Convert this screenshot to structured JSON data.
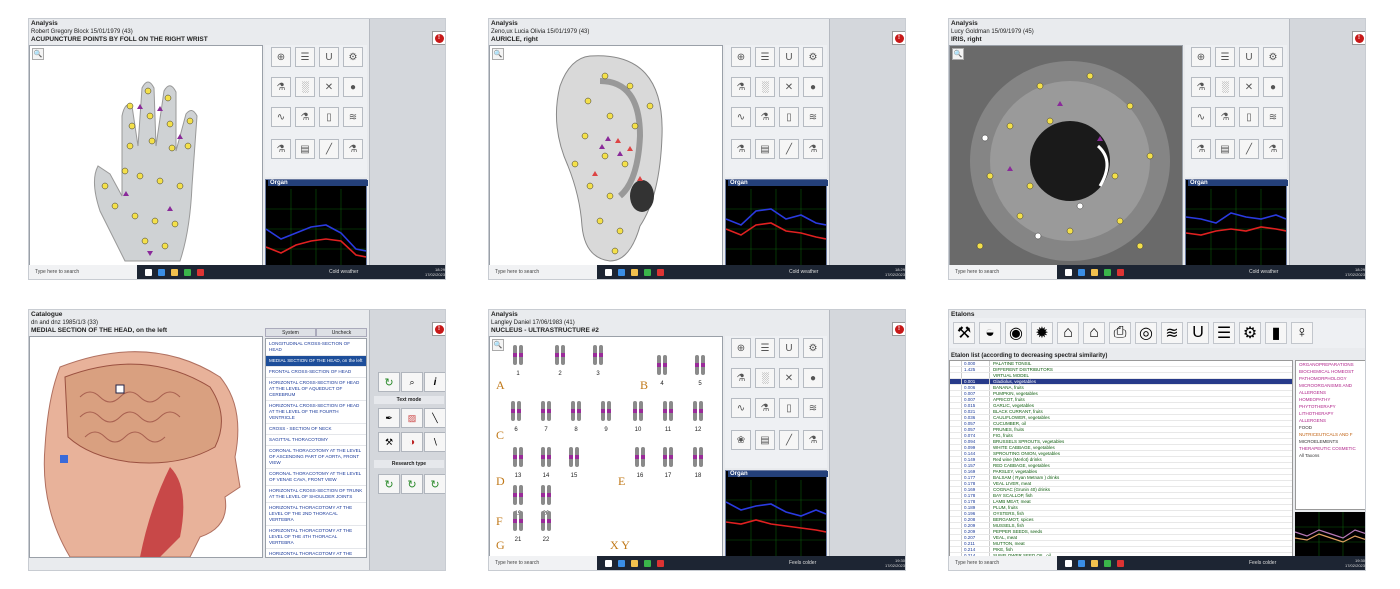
{
  "taskbar": {
    "search": "Type here to search",
    "weather_cold": "Cold weather",
    "weather_feels": "Feels colder",
    "clock_time": "18:29",
    "clock_date": "17/02/2023",
    "clock_time2": "19:30"
  },
  "panels": [
    {
      "title": "Analysis",
      "subject": "Robert Gregory Block 15/01/1979 (43)",
      "caption": "ACUPUNCTURE POINTS BY FOLL ON THE RIGHT WRIST",
      "organ": "Organ"
    },
    {
      "title": "Analysis",
      "subject": "Zeno,ux Lucia Olivia 15/01/1979 (43)",
      "caption": "AURICLE, right",
      "organ": "Organ"
    },
    {
      "title": "Analysis",
      "subject": "Lucy Goldman 15/09/1979 (45)",
      "caption": "IRIS, right",
      "organ": "Organ"
    },
    {
      "title": "Catalogue",
      "subject": "dn and dnz 1985/1/3 (33)",
      "caption": "MEDIAL SECTION OF THE HEAD, on the left",
      "tabs": [
        "System",
        "Uncheck"
      ],
      "items": [
        "LONGITUDINAL CROSS-SECTION OF HEAD",
        "MEDIAL SECTION OF THE HEAD, on the left",
        "FRONTAL CROSS-SECTION OF HEAD",
        "HORIZONTAL CROSS-SECTION OF HEAD AT THE LEVEL OF AQUEDUCT OF CEREBRUM",
        "HORIZONTAL CROSS-SECTION OF HEAD AT THE LEVEL OF THE FOURTH VENTRICLE",
        "CROSS - SECTION OF NECK",
        "SAGITTAL THORACOTOMY",
        "CORONAL THORACOTOMY AT THE LEVEL OF ASCENDING PART OF AORTA, FRONT VIEW",
        "CORONAL THORACOTOMY AT THE LEVEL OF VENAE CAVA, FRONT VIEW",
        "HORIZONTAL CROSS-SECTION OF TRUNK AT THE LEVEL OF SHOULDER JOINTS",
        "HORIZONTAL THORACOTOMY AT THE LEVEL OF THE 2ND THORACAL VERTEBRA",
        "HORIZONTAL THORACOTOMY AT THE LEVEL OF THE 4TH THORACAL VERTEBRA",
        "HORIZONTAL THORACOTOMY AT THE LEVEL OF THE 6TH THORACAL VERTEBRA"
      ],
      "text_mode": "Text mode",
      "research_type": "Research type"
    },
    {
      "title": "Analysis",
      "subject": "Langley Daniel 17/06/1983 (41)",
      "caption": "NUCLEUS - ULTRASTRUCTURE #2",
      "organ": "Organ",
      "groups": [
        "A",
        "B",
        "C",
        "D",
        "E",
        "F",
        "G",
        "X Y"
      ],
      "numbers": [
        "1",
        "2",
        "3",
        "4",
        "5",
        "6",
        "7",
        "8",
        "9",
        "10",
        "11",
        "12",
        "13",
        "14",
        "15",
        "16",
        "17",
        "18",
        "19",
        "20",
        "21",
        "22"
      ]
    },
    {
      "title": "Etalons",
      "caption": "Etalon list (according to decreasing spectral similarity)",
      "rows": [
        [
          "",
          "0.000",
          "PALATINE TONSIL"
        ],
        [
          "",
          "1.425",
          "DIFFERENT DISTRIBUTORS"
        ],
        [
          "",
          "",
          "VIRTUAL MODEL"
        ],
        [
          "",
          "0.001",
          "Gladiolus, vegetables"
        ],
        [
          "",
          "0.006",
          "BANANA, fruits"
        ],
        [
          "",
          "0.007",
          "PUMPKIN, vegetables"
        ],
        [
          "",
          "0.007",
          "APRICOT, fruits"
        ],
        [
          "",
          "0.015",
          "GARLIC, vegetables"
        ],
        [
          "",
          "0.021",
          "BLACK CURRANT, fruits"
        ],
        [
          "",
          "0.036",
          "CAULIFLOWER, vegetables"
        ],
        [
          "",
          "0.057",
          "CUCUMBER, oil"
        ],
        [
          "",
          "0.057",
          "PRUNES, fruits"
        ],
        [
          "",
          "0.074",
          "FIG, fruits"
        ],
        [
          "",
          "0.094",
          "BRUSSELS SPROUTS, vegetables"
        ],
        [
          "",
          "0.099",
          "WHITE CABBAGE, vegetables"
        ],
        [
          "",
          "0.144",
          "SPROUTING ONION, vegetables"
        ],
        [
          "",
          "0.149",
          "Red wine (Merlot) drinks"
        ],
        [
          "",
          "0.157",
          "RED CABBAGE, vegetables"
        ],
        [
          "",
          "0.169",
          "PARSLEY, vegetables"
        ],
        [
          "",
          "0.177",
          "BALSAM ( Ryan Metnam ) drinks"
        ],
        [
          "",
          "0.178",
          "VEAL LIVER, meat"
        ],
        [
          "",
          "0.169",
          "COGNAC (Grunin 40) drinks"
        ],
        [
          "",
          "0.178",
          "BAY SCALLOP, fish"
        ],
        [
          "",
          "0.178",
          "LAMB MEAT, meat"
        ],
        [
          "",
          "0.189",
          "PLUM, fruits"
        ],
        [
          "",
          "0.196",
          "OYSTERS, fish"
        ],
        [
          "",
          "0.208",
          "BERGAMOT, spices"
        ],
        [
          "",
          "0.209",
          "MUSSELS, fish"
        ],
        [
          "",
          "0.209",
          "PEPPER SEEDS, seeds"
        ],
        [
          "",
          "0.207",
          "VEAL, meat"
        ],
        [
          "",
          "0.211",
          "MUTTON, meat"
        ],
        [
          "",
          "0.214",
          "PIKE, fish"
        ],
        [
          "",
          "0.214",
          "SUNFLOWER SEED OIL, oil"
        ],
        [
          "",
          "0.216",
          "WHITE RADISH, vegetables"
        ]
      ],
      "tree": [
        "ORGANOPREPARATIONS",
        "BIOCHEMICAL HOMEOST",
        "PATHOMORPHOLOGY",
        "MICROORGANISMS AND",
        "ALLERGENS",
        "HOMEOPATHY",
        "PHYTOTHERAPY",
        "LITHOTHERAPY",
        "ALLERGENS",
        "FOOD",
        "NUTRICEUTICALS AND F",
        "MICROELEMENTS",
        "THERAPEUTIC COSMETIC",
        "All Taxons"
      ]
    }
  ]
}
